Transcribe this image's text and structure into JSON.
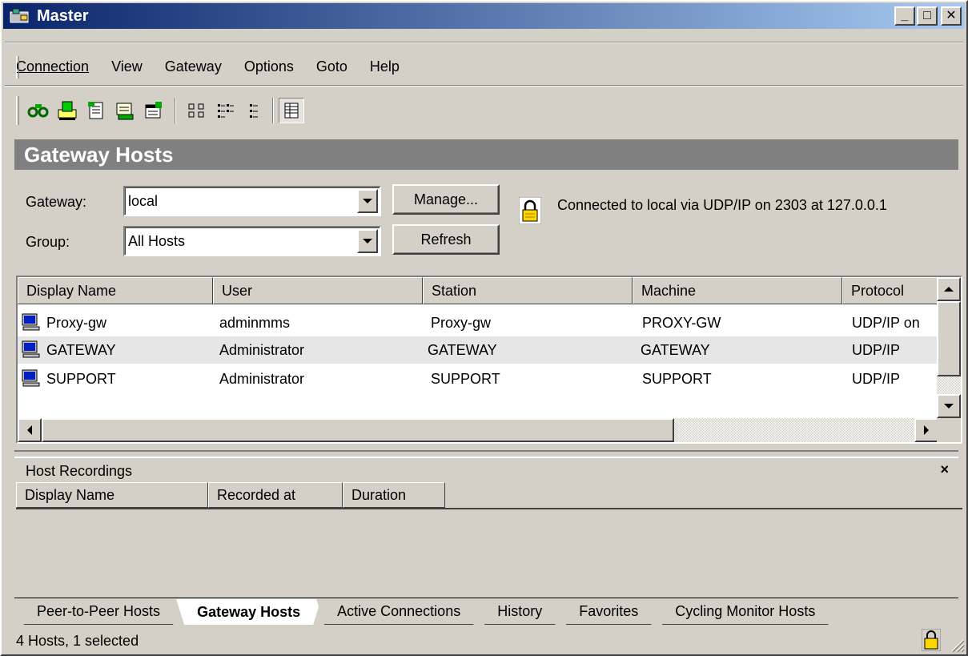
{
  "window": {
    "title": "Master",
    "controls": {
      "minimize": "_",
      "maximize": "□",
      "close": "✕"
    }
  },
  "menu": [
    "Connection",
    "View",
    "Gateway",
    "Options",
    "Goto",
    "Help"
  ],
  "toolbar": {
    "group1": [
      "connect-icon",
      "import-icon",
      "notes-icon",
      "export-icon",
      "properties-icon"
    ],
    "group2": [
      "large-icons-view-icon",
      "small-icons-view-icon",
      "list-view-icon",
      "details-view-icon"
    ]
  },
  "section_title": "Gateway Hosts",
  "form": {
    "gateway_label": "Gateway:",
    "gateway_value": "local",
    "group_label": "Group:",
    "group_value": "All Hosts",
    "manage_button": "Manage...",
    "refresh_button": "Refresh",
    "connection_status": "Connected to local via UDP/IP on 2303 at 127.0.0.1"
  },
  "hosts_table": {
    "columns": [
      "Display Name",
      "User",
      "Station",
      "Machine",
      "Protocol"
    ],
    "rows": [
      [
        "Proxy-gw",
        "adminmms",
        "Proxy-gw",
        "PROXY-GW",
        "UDP/IP on"
      ],
      [
        "GATEWAY",
        "Administrator",
        "GATEWAY",
        "GATEWAY",
        "UDP/IP"
      ],
      [
        "SUPPORT",
        "Administrator",
        "SUPPORT",
        "SUPPORT",
        "UDP/IP"
      ]
    ]
  },
  "recordings": {
    "title": "Host Recordings",
    "close": "×",
    "columns": [
      "Display Name",
      "Recorded at",
      "Duration"
    ]
  },
  "tabs": [
    "Peer-to-Peer Hosts",
    "Gateway Hosts",
    "Active Connections",
    "History",
    "Favorites",
    "Cycling Monitor Hosts"
  ],
  "active_tab": "Gateway Hosts",
  "status": "4 Hosts, 1 selected"
}
